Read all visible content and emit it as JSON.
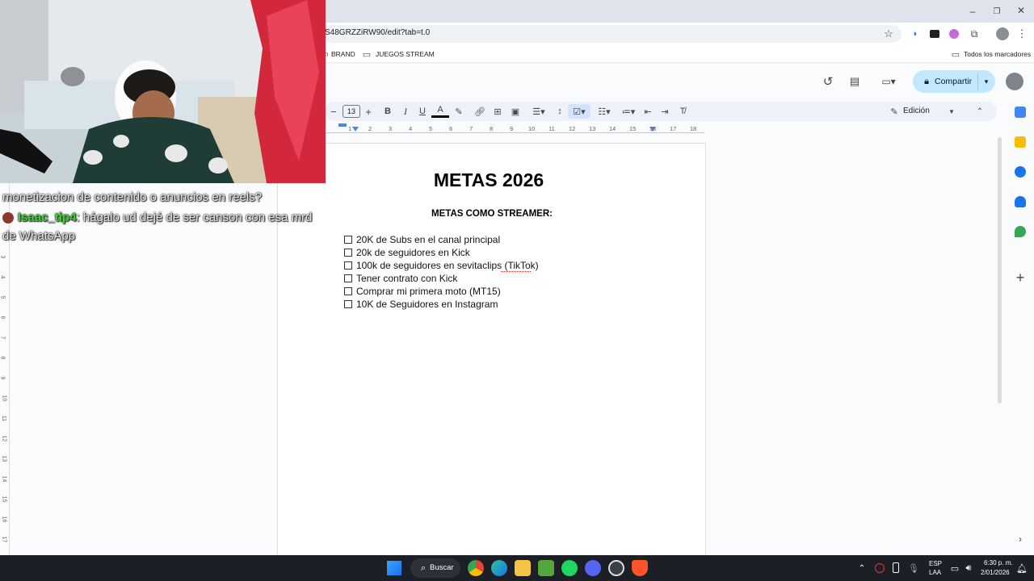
{
  "browser": {
    "url": "S48GRZZiRW90/edit?tab=t.0",
    "bookmarks": [
      "BRAND",
      "JUEGOS STREAM"
    ],
    "all_bookmarks_label": "Todos los marcadores"
  },
  "docs": {
    "share_label": "Compartir",
    "font_size": "13",
    "mode_label": "Edición"
  },
  "ruler": [
    "1",
    "2",
    "3",
    "4",
    "5",
    "6",
    "7",
    "8",
    "9",
    "10",
    "11",
    "12",
    "13",
    "14",
    "15",
    "16",
    "17",
    "18"
  ],
  "left_ruler": [
    "3",
    "4",
    "5",
    "6",
    "7",
    "8",
    "9",
    "10",
    "11",
    "12",
    "13",
    "14",
    "15",
    "16",
    "17"
  ],
  "document": {
    "title": "METAS 2026",
    "subtitle": "METAS COMO STREAMER:",
    "goals": [
      "20K de Subs en el canal principal",
      "20k de seguidores en Kick",
      "100k de seguidores en sevitaclips (TikTok)",
      "Tener contrato con Kick",
      "Comprar mi primera moto (MT15)",
      "10K de Seguidores en Instagram"
    ]
  },
  "chat": {
    "line1": "monetizacion de contenido o anuncios en reels?",
    "user": "Isaac_tip4",
    "message_part1": ": hágalo ud dejé de ser canson con esa mrd",
    "message_part2": "de WhatsApp"
  },
  "taskbar": {
    "search_label": "Buscar",
    "lang_top": "ESP",
    "lang_bottom": "LAA",
    "time": "6:30 p. m.",
    "date": "2/01/2026"
  },
  "colors": {
    "accent": "#c2e7ff",
    "chat_username": "#3bd12e",
    "spell_underline": "#d93025"
  }
}
